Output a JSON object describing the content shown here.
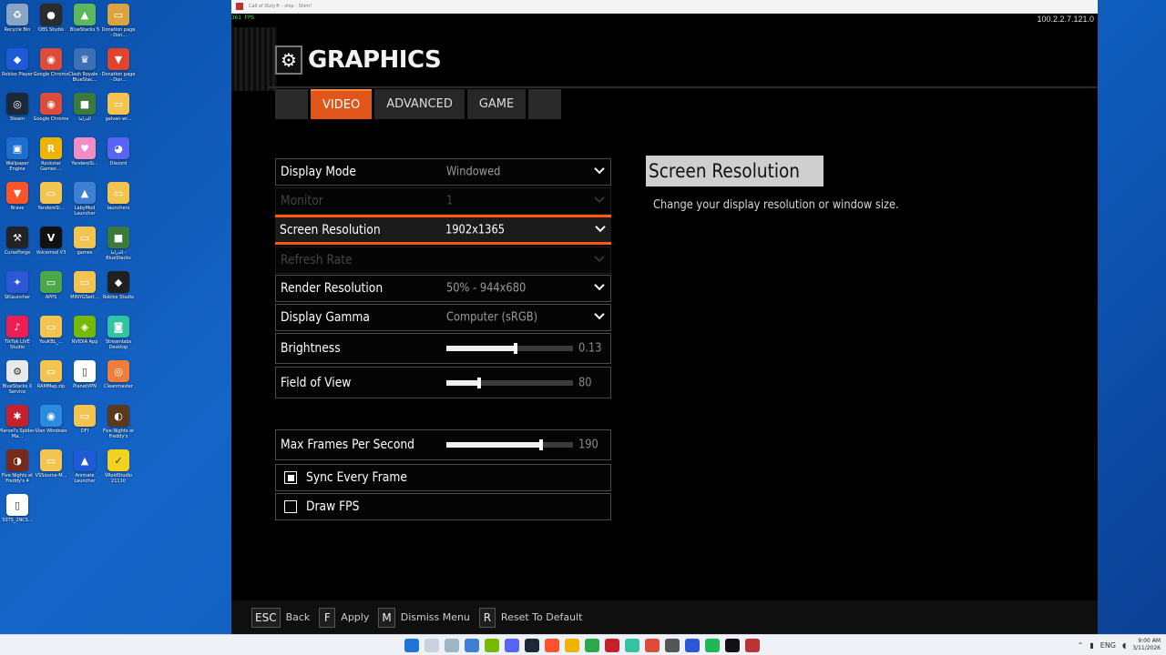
{
  "desktop": {
    "icons": [
      {
        "label": "Recycle Bin",
        "color": "#8aa4c4",
        "glyph": "♻"
      },
      {
        "label": "OBS Studio",
        "color": "#2b2b2b",
        "glyph": "●"
      },
      {
        "label": "BlueStacks 5",
        "color": "#5cb85c",
        "glyph": "▲"
      },
      {
        "label": "Donation page - Don...",
        "color": "#d9a441",
        "glyph": "▭"
      },
      {
        "label": "Roblox Player",
        "color": "#1e5ad6",
        "glyph": "◆"
      },
      {
        "label": "Google Chrome",
        "color": "#dd4b39",
        "glyph": "◉"
      },
      {
        "label": "Clash Royale - BlueStac...",
        "color": "#3c6fb4",
        "glyph": "♛"
      },
      {
        "label": "Donation page - Don...",
        "color": "#e0442c",
        "glyph": "▼"
      },
      {
        "label": "Steam",
        "color": "#1b2838",
        "glyph": "◎"
      },
      {
        "label": "Google Chrome",
        "color": "#dd4b39",
        "glyph": "◉"
      },
      {
        "label": "الدراما",
        "color": "#3b7a3b",
        "glyph": "■"
      },
      {
        "label": "galvan-wi...",
        "color": "#f3c44f",
        "glyph": "▭"
      },
      {
        "label": "Wallpaper Engine",
        "color": "#1d6fcf",
        "glyph": "▣"
      },
      {
        "label": "Rockstar Games ...",
        "color": "#f0b400",
        "glyph": "R"
      },
      {
        "label": "YandereSi...",
        "color": "#f28cc4",
        "glyph": "♥"
      },
      {
        "label": "Discord",
        "color": "#5865f2",
        "glyph": "◕"
      },
      {
        "label": "Brave",
        "color": "#fb542b",
        "glyph": "▼"
      },
      {
        "label": "YandereSi...",
        "color": "#f3c44f",
        "glyph": "▭"
      },
      {
        "label": "LabyMod Launcher",
        "color": "#3d7fd3",
        "glyph": "▲"
      },
      {
        "label": "launchers",
        "color": "#f3c44f",
        "glyph": "▭"
      },
      {
        "label": "CurseForge",
        "color": "#222222",
        "glyph": "⚒"
      },
      {
        "label": "Voicemod V3",
        "color": "#111111",
        "glyph": "V"
      },
      {
        "label": "games",
        "color": "#f3c44f",
        "glyph": "▭"
      },
      {
        "label": "الدراما - BlueStacks",
        "color": "#3b7a3b",
        "glyph": "■"
      },
      {
        "label": "SKlauncher",
        "color": "#2c58d6",
        "glyph": "✦"
      },
      {
        "label": "APPS",
        "color": "#4aa84a",
        "glyph": "▭"
      },
      {
        "label": "MINYGSett...",
        "color": "#f3c44f",
        "glyph": "▭"
      },
      {
        "label": "Roblox Studio",
        "color": "#202020",
        "glyph": "◆"
      },
      {
        "label": "TikTok LIVE Studio",
        "color": "#ee1d52",
        "glyph": "♪"
      },
      {
        "label": "YouKBL_...",
        "color": "#f3c44f",
        "glyph": "▭"
      },
      {
        "label": "NVIDIA App",
        "color": "#76b900",
        "glyph": "◈"
      },
      {
        "label": "Streamlabs Desktop",
        "color": "#31c3a2",
        "glyph": "◙"
      },
      {
        "label": "BlueStacks X Service",
        "color": "#e9e9e9",
        "glyph": "⚙"
      },
      {
        "label": "RAMMap.zip",
        "color": "#f3c44f",
        "glyph": "▭"
      },
      {
        "label": "PlanetVPN",
        "color": "#ffffff",
        "glyph": "▯"
      },
      {
        "label": "Cleanmaster",
        "color": "#f07d3a",
        "glyph": "◎"
      },
      {
        "label": "Marvel's Spider-Ma...",
        "color": "#c6202b",
        "glyph": "✱"
      },
      {
        "label": "Vian Windows",
        "color": "#2a8be0",
        "glyph": "◉"
      },
      {
        "label": "DFI",
        "color": "#f3c44f",
        "glyph": "▭"
      },
      {
        "label": "Five Nights at Freddy's",
        "color": "#5a3a1a",
        "glyph": "◐"
      },
      {
        "label": "Five Nights at Freddy's 4",
        "color": "#7a2a1a",
        "glyph": "◑"
      },
      {
        "label": "VSSource-M...",
        "color": "#f3c44f",
        "glyph": "▭"
      },
      {
        "label": "Animate Launcher",
        "color": "#1e5ad6",
        "glyph": "▲"
      },
      {
        "label": "VRoidStudio 21110",
        "color": "#f2d21e",
        "glyph": "✓"
      },
      {
        "label": "SSTS_2NCS...",
        "color": "#ffffff",
        "glyph": "▯"
      }
    ]
  },
  "window": {
    "title": "Call of Duty® - ship - Shim!",
    "fps": "361 FPS",
    "version": "100.2.2.7.121.0"
  },
  "page": {
    "title": "GRAPHICS",
    "tabs": [
      {
        "label": "VIDEO",
        "active": true
      },
      {
        "label": "ADVANCED",
        "active": false
      },
      {
        "label": "GAME",
        "active": false
      }
    ]
  },
  "settings": {
    "display_mode": {
      "label": "Display Mode",
      "value": "Windowed"
    },
    "monitor": {
      "label": "Monitor",
      "value": "1"
    },
    "screen_resolution": {
      "label": "Screen Resolution",
      "value": "1902x1365"
    },
    "refresh_rate": {
      "label": "Refresh Rate",
      "value": ""
    },
    "render_resolution": {
      "label": "Render Resolution",
      "value": "50% - 944x680"
    },
    "display_gamma": {
      "label": "Display Gamma",
      "value": "Computer (sRGB)"
    },
    "brightness": {
      "label": "Brightness",
      "value": "0.13",
      "fill": 0.55
    },
    "fov": {
      "label": "Field of View",
      "value": "80",
      "fill": 0.26
    },
    "max_fps": {
      "label": "Max Frames Per Second",
      "value": "190",
      "fill": 0.75
    },
    "sync_every_frame": {
      "label": "Sync Every Frame",
      "checked": true
    },
    "draw_fps": {
      "label": "Draw FPS",
      "checked": false
    }
  },
  "description": {
    "title": "Screen Resolution",
    "text": "Change your display resolution or window size."
  },
  "footer": {
    "esc": {
      "key": "ESC",
      "action": "Back"
    },
    "f": {
      "key": "F",
      "action": "Apply"
    },
    "m": {
      "key": "M",
      "action": "Dismiss Menu"
    },
    "r": {
      "key": "R",
      "action": "Reset To Default"
    }
  },
  "taskbar": {
    "language": "ENG",
    "time": "9:00 AM",
    "date": "3/11/2026"
  },
  "colors": {
    "accent": "#e0561a",
    "selected_border": "#ff5a14"
  }
}
